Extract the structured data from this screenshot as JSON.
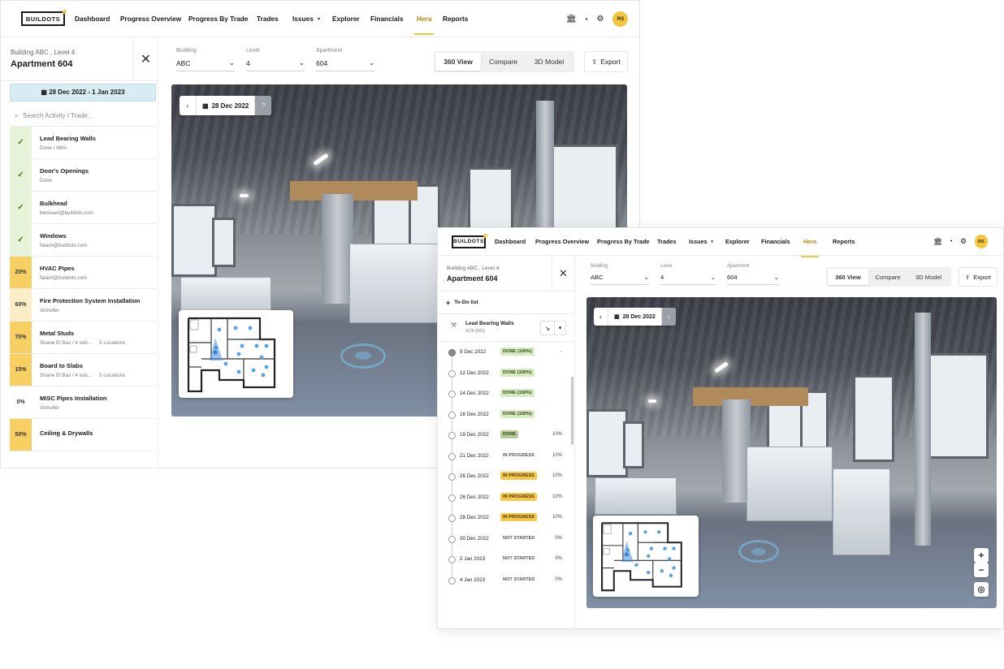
{
  "nav": {
    "logo": "BUILDOTS",
    "items": [
      "Dashboard",
      "Progress Overview",
      "Progress By Trade",
      "Trades",
      "Issues",
      "Explorer",
      "Financials",
      "Hera",
      "Reports"
    ],
    "active": "Hera",
    "avatar": "RS"
  },
  "win1": {
    "sidebar": {
      "subtitle": "Building ABC , Level 4",
      "title": "Apartment 604",
      "date_range": "28 Dec 2022 - 1 Jan 2023",
      "search_placeholder": "Search Activity / Trade...",
      "activities": [
        {
          "badge": "✓",
          "name": "Lead Bearing Walls",
          "meta": "Done / 68%",
          "meta2": "",
          "color": "#e6f3d8"
        },
        {
          "badge": "✓",
          "name": "Door's Openings",
          "meta": "Done",
          "meta2": "",
          "color": "#e6f3d8"
        },
        {
          "badge": "✓",
          "name": "Bulkhead",
          "meta": "benkeari@buildots.com",
          "meta2": "",
          "color": "#e6f3d8"
        },
        {
          "badge": "✓",
          "name": "Windows",
          "meta": "falach@buildots.com",
          "meta2": "",
          "color": "#e6f3d8"
        },
        {
          "badge": "20%",
          "name": "HVAC Pipes",
          "meta": "falach@buildots.com",
          "meta2": "",
          "color": "#f7cf63"
        },
        {
          "badge": "60%",
          "name": "Fire Protection System Installation",
          "meta": "shmuller",
          "meta2": "",
          "color": "#fbeec7"
        },
        {
          "badge": "70%",
          "name": "Metal Studs",
          "meta": "Shane El Baz / 4 sub...",
          "meta2": "5 Locations",
          "color": "#f7cf63"
        },
        {
          "badge": "15%",
          "name": "Board to Slabs",
          "meta": "Shane El Baz / 4 sub...",
          "meta2": "5 Locations",
          "color": "#f7cf63"
        },
        {
          "badge": "0%",
          "name": "MISC Pipes Installation",
          "meta": "shmuller",
          "meta2": "",
          "color": "#ffffff"
        },
        {
          "badge": "50%",
          "name": "Ceiling & Drywalls",
          "meta": "",
          "meta2": "",
          "color": "#f7cf63"
        }
      ]
    },
    "viewer_date": "28 Dec 2022"
  },
  "filters": [
    {
      "label": "Building",
      "value": "ABC"
    },
    {
      "label": "Level",
      "value": "4"
    },
    {
      "label": "Apartment",
      "value": "604"
    }
  ],
  "views": [
    "360 View",
    "Compare",
    "3D Model"
  ],
  "active_view": "360 View",
  "export": "Export",
  "win2": {
    "sidebar": {
      "subtitle": "Building ABC , Level 4",
      "title": "Apartment 604",
      "todo": "To-Do list",
      "trade_name": "Lead Bearing Walls",
      "trade_meta": "0/10 (0%)",
      "timeline": [
        {
          "date": "9 Dec 2022",
          "status": "DONE (100%)",
          "kind": "done",
          "pct": "-",
          "filled": true
        },
        {
          "date": "12 Dec 2022",
          "status": "DONE (100%)",
          "kind": "done",
          "pct": "",
          "filled": false
        },
        {
          "date": "14 Dec 2022",
          "status": "DONE (100%)",
          "kind": "done",
          "pct": "",
          "filled": false
        },
        {
          "date": "16 Dec 2022",
          "status": "DONE (100%)",
          "kind": "done",
          "pct": "",
          "filled": false
        },
        {
          "date": "19 Dec 2022",
          "status": "DONE",
          "kind": "done-dark",
          "pct": "10%",
          "filled": false
        },
        {
          "date": "21 Dec 2022",
          "status": "IN PROGRESS",
          "kind": "ns",
          "pct": "10%",
          "filled": false
        },
        {
          "date": "26 Dec 2022",
          "status": "IN PROGRESS",
          "kind": "prog",
          "pct": "10%",
          "filled": false
        },
        {
          "date": "26 Dec 2022",
          "status": "IN PROGRESS",
          "kind": "prog",
          "pct": "10%",
          "filled": false
        },
        {
          "date": "28 Dec 2022",
          "status": "IN PROGRESS",
          "kind": "prog",
          "pct": "10%",
          "filled": false
        },
        {
          "date": "30 Dec 2022",
          "status": "NOT STARTED",
          "kind": "ns",
          "pct": "0%",
          "filled": false
        },
        {
          "date": "2 Jan 2023",
          "status": "NOT STARTED",
          "kind": "ns",
          "pct": "0%",
          "filled": false
        },
        {
          "date": "4 Jan 2023",
          "status": "NOT STARTED",
          "kind": "ns",
          "pct": "0%",
          "filled": false
        }
      ]
    },
    "viewer_date": "28 Dec 2022",
    "zoom_in": "+",
    "zoom_out": "−"
  },
  "colors": {
    "accent": "#f4c640",
    "banner": "#d7ecf3",
    "done": "#d7ebc2",
    "progress": "#f5c84a"
  }
}
